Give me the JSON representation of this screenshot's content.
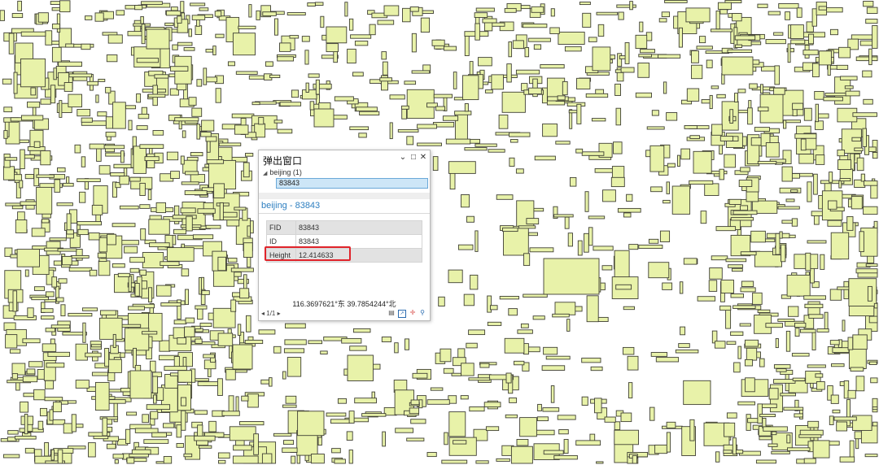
{
  "popup": {
    "title": "弹出窗口",
    "controls": {
      "collapse": "⌄",
      "maximize": "□",
      "close": "✕"
    },
    "layer_item": "beijing (1)",
    "feature_item": "83843",
    "header": "beijing - 83843",
    "attributes": [
      {
        "key": "FID",
        "value": "83843"
      },
      {
        "key": "ID",
        "value": "83843"
      },
      {
        "key": "Height",
        "value": "12.414633"
      }
    ],
    "coordinates": "116.3697621°东 39.7854244°北",
    "pager": "1/1",
    "pager_prev": "◂",
    "pager_next": "▸",
    "tools": [
      "print-icon",
      "export-icon",
      "pan-to-icon",
      "zoom-to-icon"
    ],
    "header_color": "#2e7fc0",
    "highlight_color": "#e0242b"
  },
  "map": {
    "building_fill": "#e8f2a9",
    "building_stroke": "#3f3f34"
  }
}
